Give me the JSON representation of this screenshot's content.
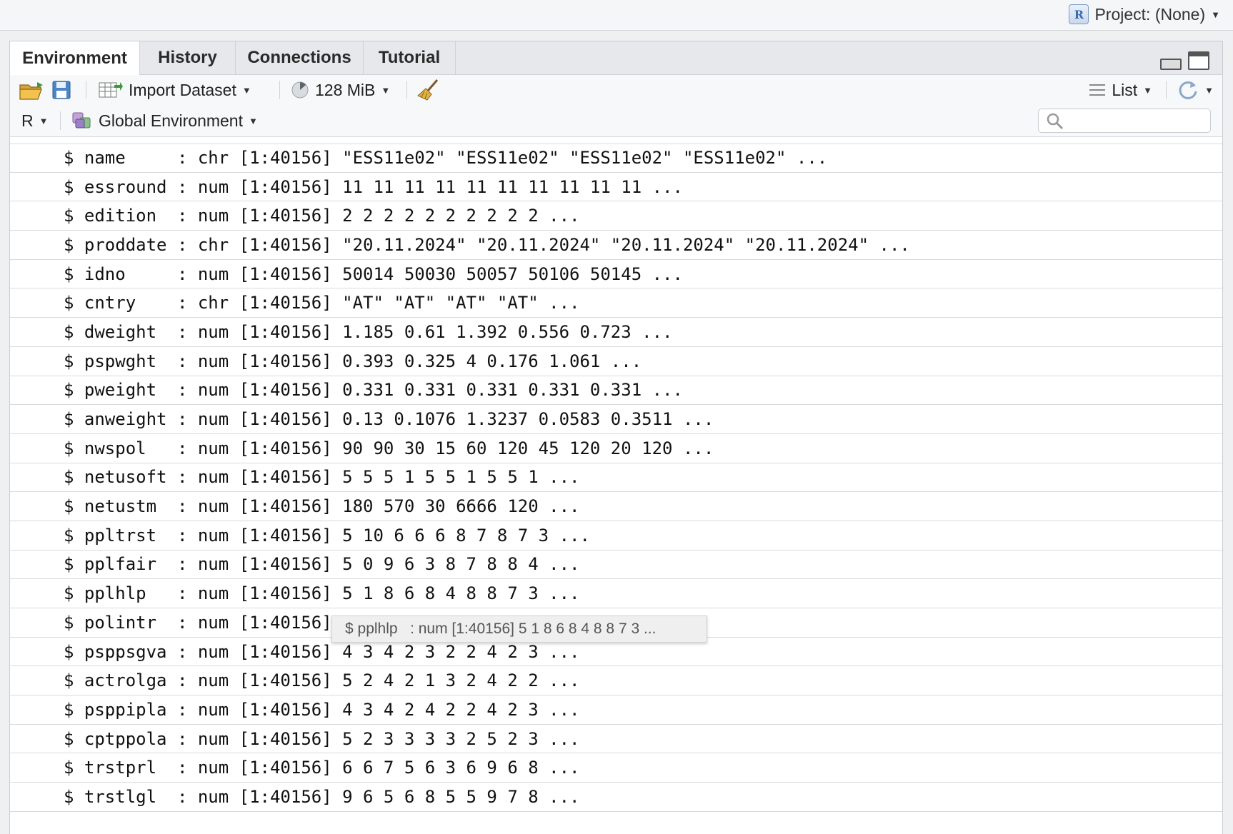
{
  "project": {
    "label": "Project: (None)",
    "icon": "r-project-icon"
  },
  "tabs": [
    {
      "label": "Environment",
      "active": true
    },
    {
      "label": "History",
      "active": false
    },
    {
      "label": "Connections",
      "active": false
    },
    {
      "label": "Tutorial",
      "active": false
    }
  ],
  "toolbar": {
    "import_label": "Import Dataset",
    "memory_label": "128 MiB",
    "view_label": "List"
  },
  "toolbar2": {
    "language_label": "R",
    "env_label": "Global Environment",
    "search_placeholder": ""
  },
  "rows": [
    "$ name     : chr [1:40156] \"ESS11e02\" \"ESS11e02\" \"ESS11e02\" \"ESS11e02\" ...",
    "$ essround : num [1:40156] 11 11 11 11 11 11 11 11 11 11 ...",
    "$ edition  : num [1:40156] 2 2 2 2 2 2 2 2 2 2 ...",
    "$ proddate : chr [1:40156] \"20.11.2024\" \"20.11.2024\" \"20.11.2024\" \"20.11.2024\" ...",
    "$ idno     : num [1:40156] 50014 50030 50057 50106 50145 ...",
    "$ cntry    : chr [1:40156] \"AT\" \"AT\" \"AT\" \"AT\" ...",
    "$ dweight  : num [1:40156] 1.185 0.61 1.392 0.556 0.723 ...",
    "$ pspwght  : num [1:40156] 0.393 0.325 4 0.176 1.061 ...",
    "$ pweight  : num [1:40156] 0.331 0.331 0.331 0.331 0.331 ...",
    "$ anweight : num [1:40156] 0.13 0.1076 1.3237 0.0583 0.3511 ...",
    "$ nwspol   : num [1:40156] 90 90 30 15 60 120 45 120 20 120 ...",
    "$ netusoft : num [1:40156] 5 5 5 1 5 5 1 5 5 1 ...",
    "$ netustm  : num [1:40156] 180 570 30 6666 120 ...",
    "$ ppltrst  : num [1:40156] 5 10 6 6 6 8 7 8 7 3 ...",
    "$ pplfair  : num [1:40156] 5 0 9 6 3 8 7 8 8 4 ...",
    "$ pplhlp   : num [1:40156] 5 1 8 6 8 4 8 8 7 3 ...",
    "$ polintr  : num [1:40156]",
    "$ psppsgva : num [1:40156] 4 3 4 2 3 2 2 4 2 3 ...",
    "$ actrolga : num [1:40156] 5 2 4 2 1 3 2 4 2 2 ...",
    "$ psppipla : num [1:40156] 4 3 4 2 4 2 2 4 2 3 ...",
    "$ cptppola : num [1:40156] 5 2 3 3 3 3 2 5 2 3 ...",
    "$ trstprl  : num [1:40156] 6 6 7 5 6 3 6 9 6 8 ...",
    "$ trstlgl  : num [1:40156] 9 6 5 6 8 5 5 9 7 8 ..."
  ],
  "tooltip": "$ pplhlp   : num [1:40156] 5 1 8 6 8 4 8 8 7 3 ..."
}
